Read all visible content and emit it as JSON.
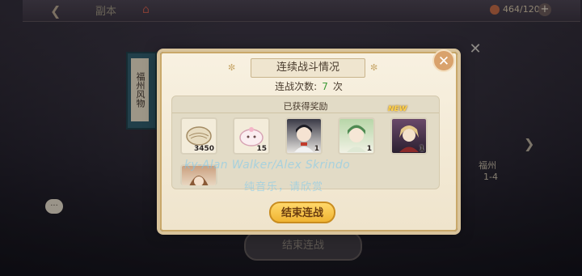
{
  "topbar": {
    "title": "副本",
    "stamina": "464/120"
  },
  "side_scroll": {
    "label": "福州风物"
  },
  "background_button": {
    "label": "结束连战"
  },
  "right_deco": {
    "line1": "福州",
    "line2": "1-4"
  },
  "dialog": {
    "title": "连续战斗情况",
    "battle_count_label": "连战次数:",
    "battle_count_value": "7",
    "battle_count_unit": "次",
    "rewards_header": "已获得奖励",
    "end_button": "结束连战",
    "new_badge": "NEW",
    "rewards": [
      {
        "name": "shell-currency",
        "qty": "3450"
      },
      {
        "name": "bun-material",
        "qty": "15"
      },
      {
        "name": "card-black-hair",
        "qty": "1"
      },
      {
        "name": "card-green-hair",
        "qty": "1"
      },
      {
        "name": "card-blonde-hair",
        "qty": "1"
      },
      {
        "name": "card-brown-hair",
        "qty": ""
      }
    ]
  },
  "watermark": {
    "line1": "ky-Alan Walker/Alex Skrindo",
    "line2": "纯音乐，请欣赏"
  },
  "colors": {
    "accent_gold": "#f0b432",
    "count_green": "#3c9a35",
    "close_orange": "#d9a26c"
  }
}
